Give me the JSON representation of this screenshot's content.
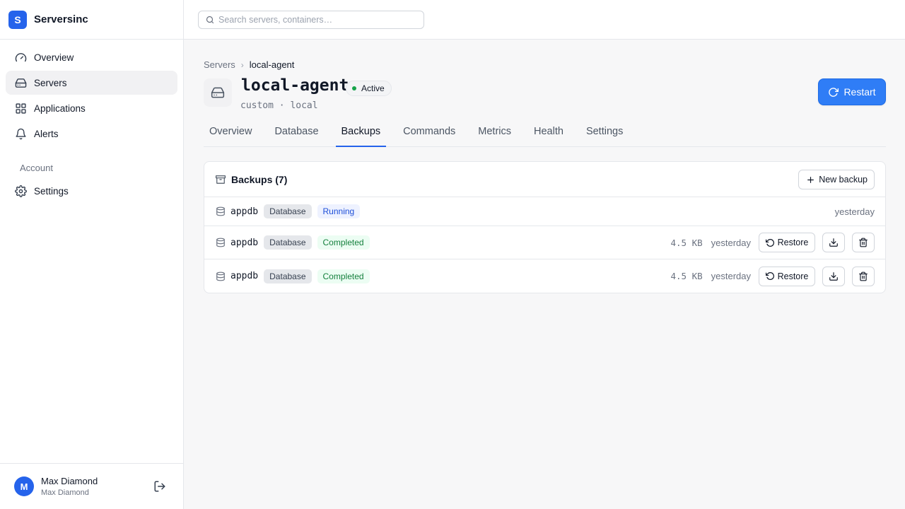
{
  "app": {
    "logo_letter": "S",
    "name": "Serversinc",
    "accent": "#2563eb"
  },
  "sidebar": {
    "items": [
      {
        "label": "Overview",
        "icon": "gauge-icon"
      },
      {
        "label": "Servers",
        "icon": "hard-drive-icon",
        "active": true
      },
      {
        "label": "Applications",
        "icon": "grid-icon"
      },
      {
        "label": "Alerts",
        "icon": "bell-icon"
      }
    ],
    "account_section": "Account",
    "account_items": [
      {
        "label": "Settings",
        "icon": "gear-icon"
      }
    ]
  },
  "user": {
    "initial": "M",
    "name": "Max Diamond",
    "subtitle": "Max Diamond"
  },
  "search": {
    "placeholder": "Search servers, containers…",
    "value": ""
  },
  "breadcrumb": {
    "parent": "Servers",
    "separator": "›",
    "current": "local-agent"
  },
  "server": {
    "name": "local-agent",
    "status": "Active",
    "status_color": "#16a34a",
    "subtitle": "custom · local",
    "restart_label": "Restart"
  },
  "tabs": [
    "Overview",
    "Database",
    "Backups",
    "Commands",
    "Metrics",
    "Health",
    "Settings"
  ],
  "active_tab": "Backups",
  "backups": {
    "title": "Backups (7)",
    "new_label": "New backup",
    "restore_label": "Restore",
    "rows": [
      {
        "name": "appdb",
        "type": "Database",
        "status": "Running",
        "size": "",
        "when": "yesterday"
      },
      {
        "name": "appdb",
        "type": "Database",
        "status": "Completed",
        "size": "4.5 KB",
        "when": "yesterday"
      },
      {
        "name": "appdb",
        "type": "Database",
        "status": "Completed",
        "size": "4.5 KB",
        "when": "yesterday"
      }
    ]
  }
}
